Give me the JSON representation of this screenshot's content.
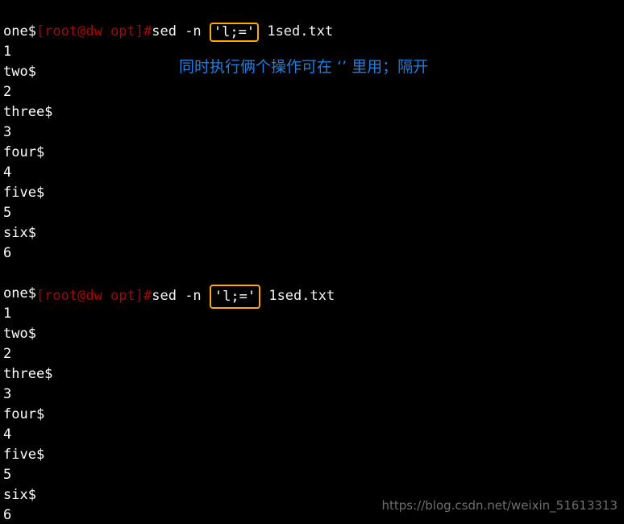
{
  "terminal": {
    "background_color": "#000000",
    "prompt_color": "#b00000",
    "text_color": "#ffffff",
    "highlight_border_color": "#ffaa00",
    "annotation_color": "#1f7fe0",
    "watermark_color": "#6e6e6e",
    "blocks": [
      {
        "prompt": "[root@dw opt]#",
        "command_before": "sed -n ",
        "command_highlight": "'l;='",
        "command_after": " 1sed.txt",
        "output": [
          "one$",
          "1",
          "two$",
          "2",
          "three$",
          "3",
          "four$",
          "4",
          "five$",
          "5",
          "six$",
          "6"
        ]
      },
      {
        "prompt": "[root@dw opt]#",
        "command_before": "sed -n ",
        "command_highlight": "'l;='",
        "command_after": " 1sed.txt",
        "output": [
          "one$",
          "1",
          "two$",
          "2",
          "three$",
          "3",
          "four$",
          "4",
          "five$",
          "5",
          "six$",
          "6"
        ]
      }
    ]
  },
  "annotation": {
    "text": "同时执行俩个操作可在 ‘’ 里用；隔开"
  },
  "watermark": {
    "text": "https://blog.csdn.net/weixin_51613313"
  }
}
